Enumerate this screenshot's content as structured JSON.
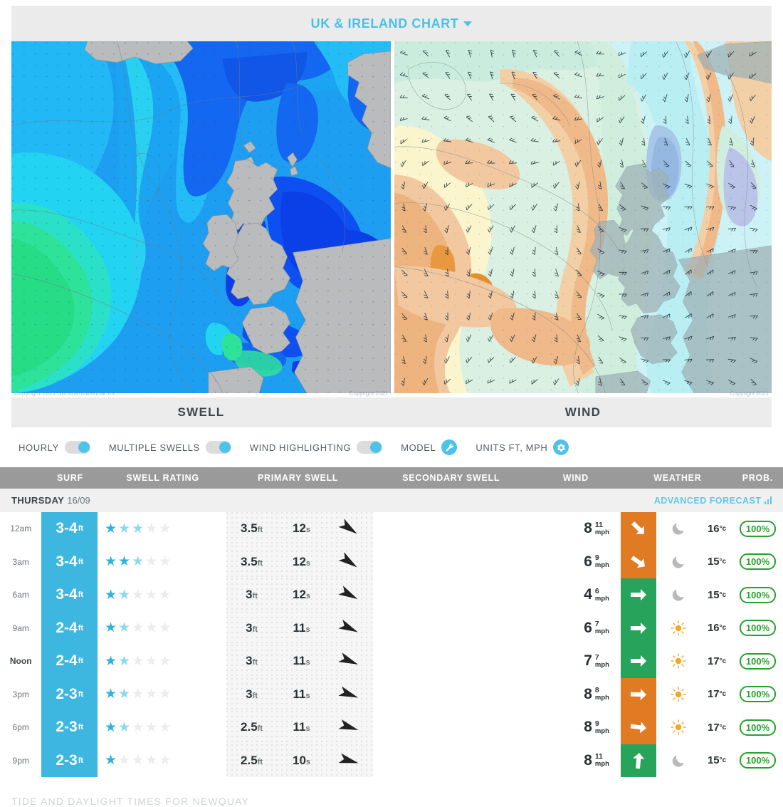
{
  "chart_header": {
    "title": "UK & IRELAND CHART",
    "caret": "chevron-down-icon"
  },
  "maps": {
    "swell": {
      "caption": "SWELL",
      "watermark": "Copyright 2021 Surfline\\Wavetrak Inc."
    },
    "wind": {
      "caption": "WIND",
      "watermark": "Copyright 2021"
    }
  },
  "toggles": [
    {
      "label": "HOURLY",
      "state": "on",
      "type": "switch"
    },
    {
      "label": "MULTIPLE SWELLS",
      "state": "on",
      "type": "switch"
    },
    {
      "label": "WIND HIGHLIGHTING",
      "state": "on",
      "type": "switch"
    },
    {
      "label": "MODEL",
      "state": "on",
      "type": "icon",
      "icon": "wrench-icon"
    },
    {
      "label": "UNITS FT, MPH",
      "state": "on",
      "type": "icon",
      "icon": "gear-icon"
    }
  ],
  "table": {
    "columns": [
      "",
      "SURF",
      "SWELL RATING",
      "PRIMARY SWELL",
      "SECONDARY SWELL",
      "WIND",
      "",
      "WEATHER",
      "",
      "PROB."
    ],
    "day": {
      "name": "THURSDAY",
      "date": "16/09",
      "advanced_label": "ADVANCED FORECAST",
      "advanced_icon": "bar-chart-icon"
    },
    "rows": [
      {
        "time": "12am",
        "surf": "3-4",
        "surf_unit": "ft",
        "stars": [
          "full",
          "half",
          "half",
          "empty",
          "empty"
        ],
        "swell_height": "3.5",
        "swell_height_unit": "ft",
        "swell_period": "12",
        "swell_period_unit": "s",
        "swell_arrow_deg": 125,
        "secondary": "",
        "wind": "8",
        "gust": "11",
        "wind_unit": "mph",
        "wind_dir_deg": 135,
        "wind_color": "#e07b24",
        "weather": "moon-icon",
        "temp": "16",
        "temp_unit": "°c",
        "prob": "100%"
      },
      {
        "time": "3am",
        "surf": "3-4",
        "surf_unit": "ft",
        "stars": [
          "full",
          "full",
          "half",
          "empty",
          "empty"
        ],
        "swell_height": "3.5",
        "swell_height_unit": "ft",
        "swell_period": "12",
        "swell_period_unit": "s",
        "swell_arrow_deg": 125,
        "secondary": "",
        "wind": "6",
        "gust": "9",
        "wind_unit": "mph",
        "wind_dir_deg": 125,
        "wind_color": "#e07b24",
        "weather": "moon-icon",
        "temp": "15",
        "temp_unit": "°c",
        "prob": "100%"
      },
      {
        "time": "6am",
        "surf": "3-4",
        "surf_unit": "ft",
        "stars": [
          "full",
          "half",
          "empty",
          "empty",
          "empty"
        ],
        "swell_height": "3",
        "swell_height_unit": "ft",
        "swell_period": "12",
        "swell_period_unit": "s",
        "swell_arrow_deg": 118,
        "secondary": "",
        "wind": "4",
        "gust": "6",
        "wind_unit": "mph",
        "wind_dir_deg": 90,
        "wind_color": "#28a35b",
        "weather": "moon-icon",
        "temp": "15",
        "temp_unit": "°c",
        "prob": "100%"
      },
      {
        "time": "9am",
        "surf": "2-4",
        "surf_unit": "ft",
        "stars": [
          "full",
          "half",
          "empty",
          "empty",
          "empty"
        ],
        "swell_height": "3",
        "swell_height_unit": "ft",
        "swell_period": "11",
        "swell_period_unit": "s",
        "swell_arrow_deg": 115,
        "secondary": "",
        "wind": "6",
        "gust": "7",
        "wind_unit": "mph",
        "wind_dir_deg": 90,
        "wind_color": "#28a35b",
        "weather": "sun-icon",
        "temp": "16",
        "temp_unit": "°c",
        "prob": "100%"
      },
      {
        "time": "Noon",
        "surf": "2-4",
        "surf_unit": "ft",
        "stars": [
          "full",
          "half",
          "empty",
          "empty",
          "empty"
        ],
        "swell_height": "3",
        "swell_height_unit": "ft",
        "swell_period": "11",
        "swell_period_unit": "s",
        "swell_arrow_deg": 112,
        "secondary": "",
        "wind": "7",
        "gust": "7",
        "wind_unit": "mph",
        "wind_dir_deg": 90,
        "wind_color": "#28a35b",
        "weather": "sun-icon",
        "temp": "17",
        "temp_unit": "°c",
        "prob": "100%"
      },
      {
        "time": "3pm",
        "surf": "2-3",
        "surf_unit": "ft",
        "stars": [
          "full",
          "half",
          "empty",
          "empty",
          "empty"
        ],
        "swell_height": "3",
        "swell_height_unit": "ft",
        "swell_period": "11",
        "swell_period_unit": "s",
        "swell_arrow_deg": 110,
        "secondary": "",
        "wind": "8",
        "gust": "8",
        "wind_unit": "mph",
        "wind_dir_deg": 92,
        "wind_color": "#e07b24",
        "weather": "sun-icon",
        "temp": "17",
        "temp_unit": "°c",
        "prob": "100%"
      },
      {
        "time": "6pm",
        "surf": "2-3",
        "surf_unit": "ft",
        "stars": [
          "full",
          "half",
          "empty",
          "empty",
          "empty"
        ],
        "swell_height": "2.5",
        "swell_height_unit": "ft",
        "swell_period": "11",
        "swell_period_unit": "s",
        "swell_arrow_deg": 108,
        "secondary": "",
        "wind": "8",
        "gust": "9",
        "wind_unit": "mph",
        "wind_dir_deg": 98,
        "wind_color": "#e07b24",
        "weather": "sun-icon",
        "temp": "17",
        "temp_unit": "°c",
        "prob": "100%"
      },
      {
        "time": "9pm",
        "surf": "2-3",
        "surf_unit": "ft",
        "stars": [
          "full",
          "empty",
          "empty",
          "empty",
          "empty"
        ],
        "swell_height": "2.5",
        "swell_height_unit": "ft",
        "swell_period": "10",
        "swell_period_unit": "s",
        "swell_arrow_deg": 105,
        "secondary": "",
        "wind": "8",
        "gust": "11",
        "wind_unit": "mph",
        "wind_dir_deg": 5,
        "wind_color": "#28a35b",
        "weather": "moon-icon",
        "temp": "15",
        "temp_unit": "°c",
        "prob": "100%"
      }
    ]
  },
  "tide_section": {
    "heading": "TIDE AND DAYLIGHT TIMES FOR NEWQUAY"
  },
  "colors": {
    "accent": "#48c1e9",
    "surf_bg": "#3eb7e0",
    "wind_green": "#28a35b",
    "wind_orange": "#e07b24",
    "prob_green": "#25a32b",
    "header_grey": "#9a9a9a"
  }
}
